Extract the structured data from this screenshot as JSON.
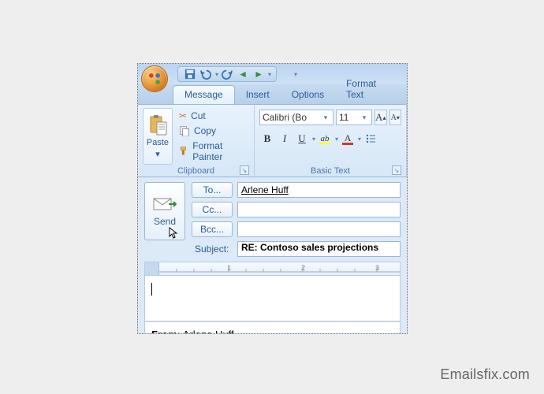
{
  "watermark": "Emailsfix.com",
  "tabs": {
    "message": "Message",
    "insert": "Insert",
    "options": "Options",
    "format_text": "Format Text"
  },
  "clipboard": {
    "paste": "Paste",
    "cut": "Cut",
    "copy": "Copy",
    "format_painter": "Format Painter",
    "group_title": "Clipboard"
  },
  "font": {
    "font_name": "Calibri (Bo",
    "font_size": "11",
    "group_title": "Basic Text"
  },
  "compose": {
    "send": "Send",
    "to_btn": "To...",
    "cc_btn": "Cc...",
    "bcc_btn": "Bcc...",
    "subject_label": "Subject:",
    "to_value": "Arlene Huff",
    "cc_value": "",
    "bcc_value": "",
    "subject_value": "RE: Contoso sales projections"
  },
  "body": {
    "from_label": "From:",
    "from_value": "Arlene Huff"
  },
  "ruler": {
    "n1": "1",
    "n2": "2",
    "n3": "3"
  }
}
